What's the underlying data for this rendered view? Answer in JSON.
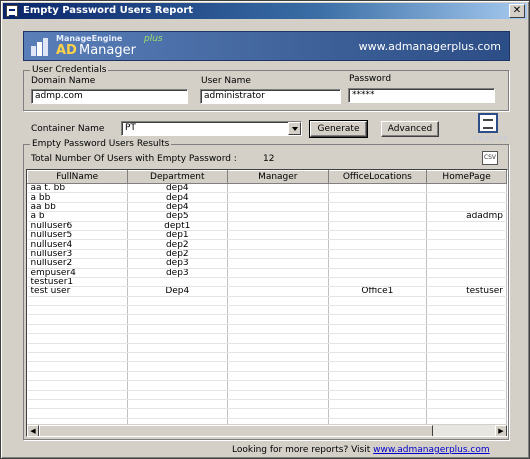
{
  "window": {
    "title": "Empty  Password Users Report",
    "close_glyph": "✕"
  },
  "banner": {
    "brand_small": "ManageEngine",
    "brand_ad": "AD",
    "brand_manager": "Manager",
    "brand_plus": "plus",
    "url": "www.admanagerplus.com"
  },
  "credentials": {
    "legend": "User Credentials",
    "domain_label": "Domain Name",
    "domain_value": "admp.com",
    "user_label": "User Name",
    "user_value": "administrator",
    "password_label": "Password",
    "password_value": "*****"
  },
  "container": {
    "label": "Container Name",
    "value": "PT",
    "generate_label": "Generate",
    "advanced_label": "Advanced"
  },
  "readme": {
    "label": "README",
    "icon": "readme-doc-icon"
  },
  "results": {
    "legend": "Empty Password Users Results",
    "count_label": "Total Number Of Users with Empty Password :",
    "count_value": "12",
    "csv_icon": "csv-export-icon",
    "csv_text": "CSV"
  },
  "grid": {
    "columns": [
      "FullName",
      "Department",
      "Manager",
      "OfficeLocations",
      "HomePage"
    ],
    "rows": [
      [
        "aa t. bb",
        "dep4",
        "",
        "",
        ""
      ],
      [
        "a bb",
        "dep4",
        "",
        "",
        ""
      ],
      [
        "aa bb",
        "dep4",
        "",
        "",
        ""
      ],
      [
        "a b",
        "dep5",
        "",
        "",
        "adadmp"
      ],
      [
        "nulluser6",
        "dept1",
        "",
        "",
        ""
      ],
      [
        "nulluser5",
        "dep1",
        "",
        "",
        ""
      ],
      [
        "nulluser4",
        "dep2",
        "",
        "",
        ""
      ],
      [
        "nulluser3",
        "dep2",
        "",
        "",
        ""
      ],
      [
        "nulluser2",
        "dep3",
        "",
        "",
        ""
      ],
      [
        "empuser4",
        "dep3",
        "",
        "",
        ""
      ],
      [
        "testuser1",
        "",
        "",
        "",
        ""
      ],
      [
        "test user",
        "Dep4",
        "",
        "Office1",
        "testuser"
      ]
    ],
    "empty_row_count": 15,
    "scroll_left_glyph": "◀",
    "scroll_right_glyph": "▶"
  },
  "footer": {
    "text": "Looking for more reports? Visit",
    "link": "www.admanagerplus.com"
  }
}
